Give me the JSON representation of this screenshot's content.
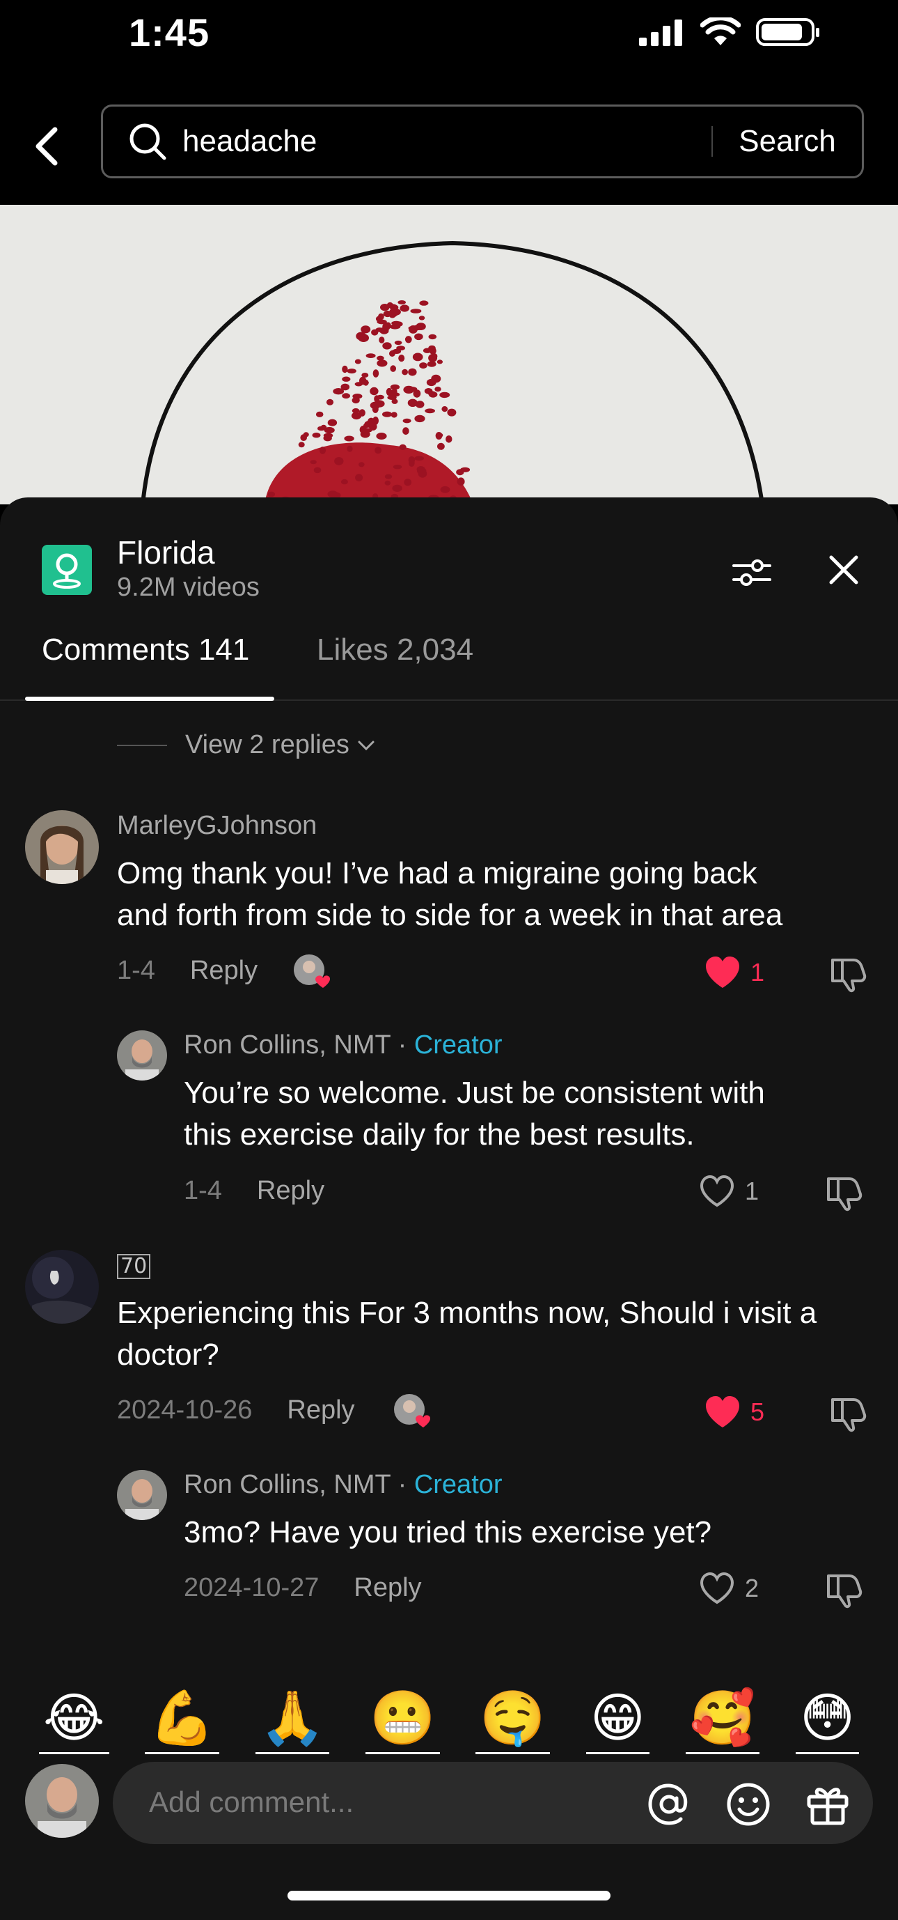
{
  "status_bar": {
    "time": "1:45",
    "icons": [
      "signal-icon",
      "wifi-icon",
      "battery-icon"
    ]
  },
  "search": {
    "query": "headache",
    "button_label": "Search"
  },
  "location": {
    "title": "Florida",
    "subtitle": "9.2M videos"
  },
  "tabs": {
    "comments": "Comments 141",
    "likes": "Likes 2,034"
  },
  "view_replies": "View 2 replies",
  "comments": [
    {
      "username": "MarleyGJohnson",
      "text_line1": "Omg thank you! I’ve had a migraine going back",
      "text_line2": "and forth from side to side for a week in that area",
      "date": "1-4",
      "reply_label": "Reply",
      "likes": "1",
      "liked": true,
      "reply": {
        "username": "Ron Collins, NMT",
        "creator_label": "Creator",
        "text_line1": "You’re so welcome. Just be consistent with",
        "text_line2": "this exercise daily for the best results.",
        "date": "1-4",
        "reply_label": "Reply",
        "likes": "1"
      }
    },
    {
      "username_badge": "70",
      "text_line1": "Experiencing this For 3 months now, Should i visit a",
      "text_line2": "doctor?",
      "date": "2024-10-26",
      "reply_label": "Reply",
      "likes": "5",
      "liked": true,
      "reply": {
        "username": "Ron Collins, NMT",
        "creator_label": "Creator",
        "text_line1": "3mo? Have you tried this exercise yet?",
        "date": "2024-10-27",
        "reply_label": "Reply",
        "likes": "2"
      }
    }
  ],
  "emojis": [
    "😂",
    "💪",
    "🙏",
    "😬",
    "🤤",
    "😁",
    "🥰",
    "😳"
  ],
  "composer": {
    "placeholder": "Add comment..."
  },
  "colors": {
    "like_red": "#fe2c55",
    "creator_blue": "#2bb3d8",
    "location_green": "#20c08f",
    "sheet_bg": "#141414"
  }
}
